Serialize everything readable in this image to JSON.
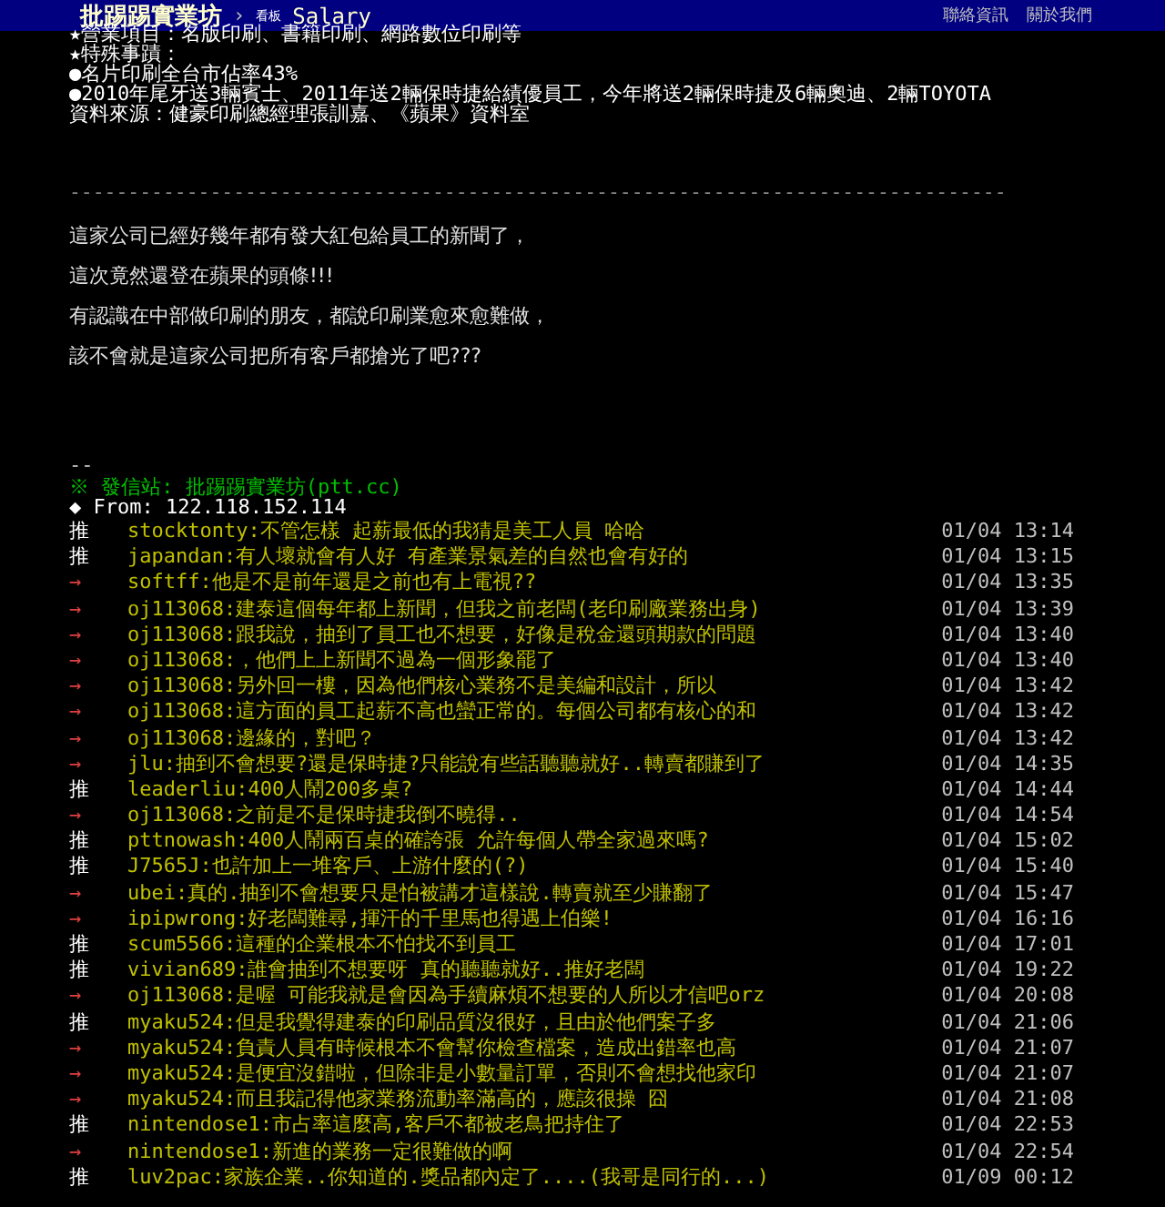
{
  "header": {
    "site_title": "批踢踢實業坊",
    "separator": "›",
    "board_badge": "看板",
    "board_name": "Salary",
    "links": [
      "聯絡資訊",
      "關於我們"
    ]
  },
  "info_lines": [
    "★營業項目：名版印刷、書籍印刷、網路數位印刷等",
    "★特殊事蹟：",
    "●名片印刷全台市佔率43%",
    "●2010年尾牙送3輛賓士、2011年送2輛保時捷給績優員工，今年將送2輛保時捷及6輛奧迪、2輛TOYOTA",
    "資料來源：健豪印刷總經理張訓嘉、《蘋果》資料室"
  ],
  "divider": "--------------------------------------------------------------------------------",
  "paragraphs": [
    "這家公司已經好幾年都有發大紅包給員工的新聞了，",
    "這次竟然還登在蘋果的頭條!!!",
    "有認識在中部做印刷的朋友，都說印刷業愈來愈難做，",
    "該不會就是這家公司把所有客戶都搶光了吧???"
  ],
  "signature": "--",
  "origin": "※ 發信站: 批踢踢實業坊(ptt.cc)",
  "from": "◆ From: 122.118.152.114",
  "comments": [
    {
      "kind": "push",
      "tag": "推",
      "user": "stocktonty",
      "text": ":不管怎樣 起薪最低的我猜是美工人員 哈哈",
      "time": "01/04 13:14"
    },
    {
      "kind": "push",
      "tag": "推",
      "user": "japandan",
      "text": ":有人壞就會有人好 有產業景氣差的自然也會有好的",
      "time": "01/04 13:15"
    },
    {
      "kind": "arrow",
      "tag": "→",
      "user": "softff",
      "text": ":他是不是前年還是之前也有上電視??",
      "time": "01/04 13:35"
    },
    {
      "kind": "arrow",
      "tag": "→",
      "user": "oj113068",
      "text": ":建泰這個每年都上新聞，但我之前老闆(老印刷廠業務出身)",
      "time": "01/04 13:39"
    },
    {
      "kind": "arrow",
      "tag": "→",
      "user": "oj113068",
      "text": ":跟我說，抽到了員工也不想要，好像是稅金還頭期款的問題",
      "time": "01/04 13:40"
    },
    {
      "kind": "arrow",
      "tag": "→",
      "user": "oj113068",
      "text": ":，他們上上新聞不過為一個形象罷了",
      "time": "01/04 13:40"
    },
    {
      "kind": "arrow",
      "tag": "→",
      "user": "oj113068",
      "text": ":另外回一樓，因為他們核心業務不是美編和設計，所以",
      "time": "01/04 13:42"
    },
    {
      "kind": "arrow",
      "tag": "→",
      "user": "oj113068",
      "text": ":這方面的員工起薪不高也蠻正常的。每個公司都有核心的和",
      "time": "01/04 13:42"
    },
    {
      "kind": "arrow",
      "tag": "→",
      "user": "oj113068",
      "text": ":邊緣的，對吧？",
      "time": "01/04 13:42"
    },
    {
      "kind": "arrow",
      "tag": "→",
      "user": "jlu",
      "text": ":抽到不會想要?還是保時捷?只能說有些話聽聽就好..轉賣都賺到了",
      "time": "01/04 14:35"
    },
    {
      "kind": "push",
      "tag": "推",
      "user": "leaderliu",
      "text": ":400人鬧200多桌?",
      "time": "01/04 14:44"
    },
    {
      "kind": "arrow",
      "tag": "→",
      "user": "oj113068",
      "text": ":之前是不是保時捷我倒不曉得..",
      "time": "01/04 14:54"
    },
    {
      "kind": "push",
      "tag": "推",
      "user": "pttnowash",
      "text": ":400人鬧兩百桌的確誇張 允許每個人帶全家過來嗎?",
      "time": "01/04 15:02"
    },
    {
      "kind": "push",
      "tag": "推",
      "user": "J7565J",
      "text": ":也許加上一堆客戶、上游什麼的(?)",
      "time": "01/04 15:40"
    },
    {
      "kind": "arrow",
      "tag": "→",
      "user": "ubei",
      "text": ":真的.抽到不會想要只是怕被講才這樣說.轉賣就至少賺翻了",
      "time": "01/04 15:47"
    },
    {
      "kind": "arrow",
      "tag": "→",
      "user": "ipipwrong",
      "text": ":好老闆難尋,揮汗的千里馬也得遇上伯樂!",
      "time": "01/04 16:16"
    },
    {
      "kind": "push",
      "tag": "推",
      "user": "scum5566",
      "text": ":這種的企業根本不怕找不到員工",
      "time": "01/04 17:01"
    },
    {
      "kind": "push",
      "tag": "推",
      "user": "vivian689",
      "text": ":誰會抽到不想要呀 真的聽聽就好..推好老闆",
      "time": "01/04 19:22"
    },
    {
      "kind": "arrow",
      "tag": "→",
      "user": "oj113068",
      "text": ":是喔 可能我就是會因為手續麻煩不想要的人所以才信吧orz",
      "time": "01/04 20:08"
    },
    {
      "kind": "push",
      "tag": "推",
      "user": "myaku524",
      "text": ":但是我覺得建泰的印刷品質沒很好，且由於他們案子多",
      "time": "01/04 21:06"
    },
    {
      "kind": "arrow",
      "tag": "→",
      "user": "myaku524",
      "text": ":負責人員有時候根本不會幫你檢查檔案，造成出錯率也高",
      "time": "01/04 21:07"
    },
    {
      "kind": "arrow",
      "tag": "→",
      "user": "myaku524",
      "text": ":是便宜沒錯啦，但除非是小數量訂單，否則不會想找他家印",
      "time": "01/04 21:07"
    },
    {
      "kind": "arrow",
      "tag": "→",
      "user": "myaku524",
      "text": ":而且我記得他家業務流動率滿高的，應該很操 囧",
      "time": "01/04 21:08"
    },
    {
      "kind": "push",
      "tag": "推",
      "user": "nintendose1",
      "text": ":市占率這麼高,客戶不都被老鳥把持住了",
      "time": "01/04 22:53"
    },
    {
      "kind": "arrow",
      "tag": "→",
      "user": "nintendose1",
      "text": ":新進的業務一定很難做的啊",
      "time": "01/04 22:54"
    },
    {
      "kind": "push",
      "tag": "推",
      "user": "luv2pac",
      "text": ":家族企業..你知道的.獎品都內定了....(我哥是同行的...)",
      "time": "01/09 00:12"
    }
  ]
}
